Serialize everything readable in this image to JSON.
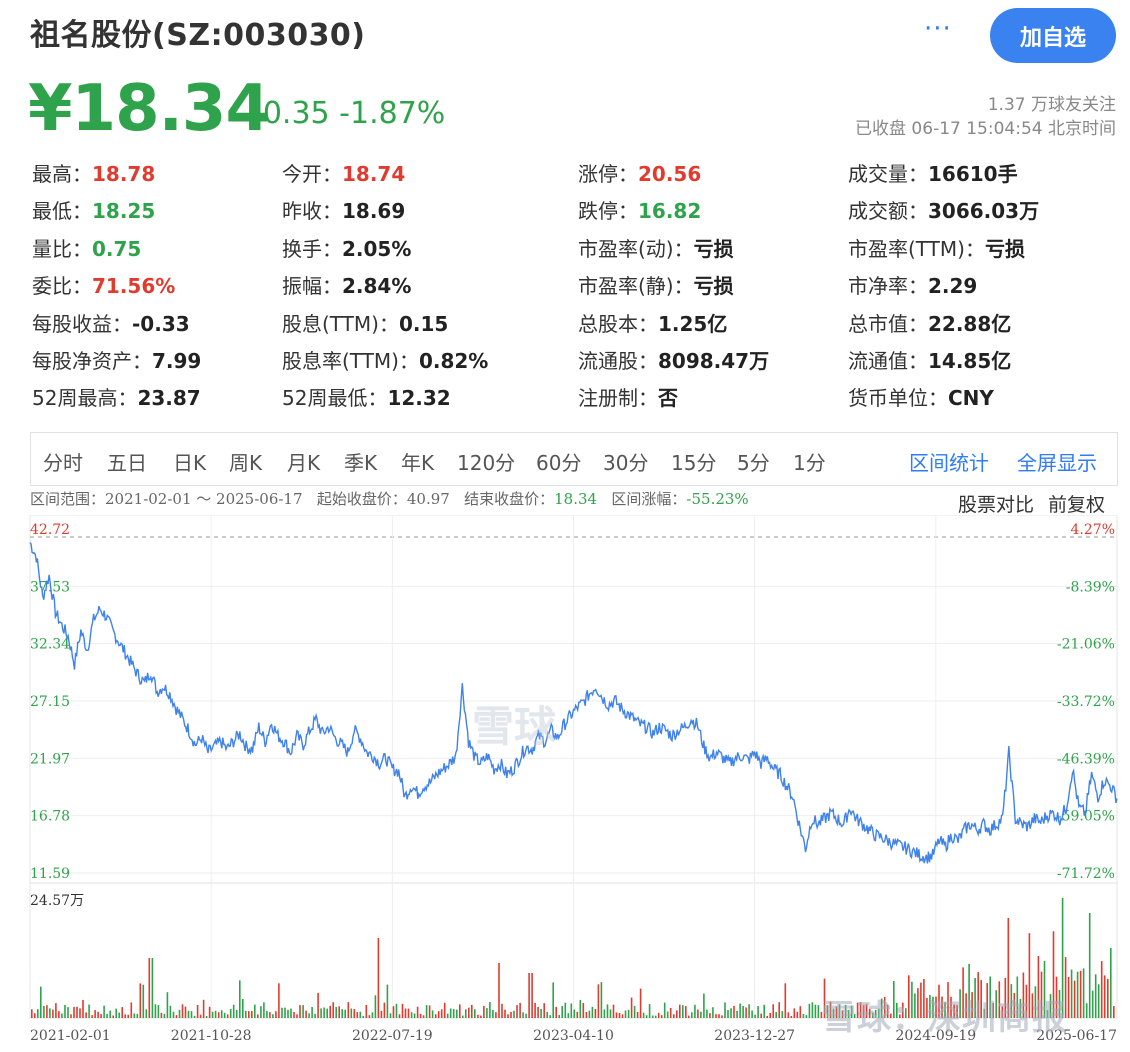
{
  "header": {
    "title": "祖名股份(SZ:003030)",
    "add_label": "加自选",
    "more_label": "···"
  },
  "quote": {
    "price": "¥18.34",
    "change": "-0.35 -1.87%",
    "followers": "1.37 万球友关注",
    "status": "已收盘 06-17 15:04:54 北京时间"
  },
  "stats": [
    {
      "label": "最高：",
      "value": "18.78",
      "color": "red"
    },
    {
      "label": "今开：",
      "value": "18.74",
      "color": "red"
    },
    {
      "label": "涨停：",
      "value": "20.56",
      "color": "red"
    },
    {
      "label": "成交量：",
      "value": "16610手",
      "color": ""
    },
    {
      "label": "最低：",
      "value": "18.25",
      "color": "green"
    },
    {
      "label": "昨收：",
      "value": "18.69",
      "color": ""
    },
    {
      "label": "跌停：",
      "value": "16.82",
      "color": "green"
    },
    {
      "label": "成交额：",
      "value": "3066.03万",
      "color": ""
    },
    {
      "label": "量比：",
      "value": "0.75",
      "color": "green"
    },
    {
      "label": "换手：",
      "value": "2.05%",
      "color": ""
    },
    {
      "label": "市盈率(动)：",
      "value": "亏损",
      "color": ""
    },
    {
      "label": "市盈率(TTM)：",
      "value": "亏损",
      "color": ""
    },
    {
      "label": "委比：",
      "value": "71.56%",
      "color": "red"
    },
    {
      "label": "振幅：",
      "value": "2.84%",
      "color": ""
    },
    {
      "label": "市盈率(静)：",
      "value": "亏损",
      "color": ""
    },
    {
      "label": "市净率：",
      "value": "2.29",
      "color": ""
    },
    {
      "label": "每股收益：",
      "value": "-0.33",
      "color": ""
    },
    {
      "label": "股息(TTM)：",
      "value": "0.15",
      "color": ""
    },
    {
      "label": "总股本：",
      "value": "1.25亿",
      "color": ""
    },
    {
      "label": "总市值：",
      "value": "22.88亿",
      "color": ""
    },
    {
      "label": "每股净资产：",
      "value": "7.99",
      "color": ""
    },
    {
      "label": "股息率(TTM)：",
      "value": "0.82%",
      "color": ""
    },
    {
      "label": "流通股：",
      "value": "8098.47万",
      "color": ""
    },
    {
      "label": "流通值：",
      "value": "14.85亿",
      "color": ""
    },
    {
      "label": "52周最高：",
      "value": "23.87",
      "color": ""
    },
    {
      "label": "52周最低：",
      "value": "12.32",
      "color": ""
    },
    {
      "label": "注册制：",
      "value": "否",
      "color": ""
    },
    {
      "label": "货币单位：",
      "value": "CNY",
      "color": ""
    }
  ],
  "tabs": [
    "分时",
    "五日",
    "日K",
    "周K",
    "月K",
    "季K",
    "年K",
    "120分",
    "60分",
    "30分",
    "15分",
    "5分",
    "1分"
  ],
  "tab_actions": [
    "区间统计",
    "全屏显示"
  ],
  "range": {
    "range_label": "区间范围：",
    "range_value": "2021-02-01 ～ 2025-06-17",
    "start_label": "起始收盘价：",
    "start_value": "40.97",
    "end_label": "结束收盘价：",
    "end_value": "18.34",
    "pct_label": "区间涨幅：",
    "pct_value": "-55.23%",
    "compare": "股票对比",
    "adjust": "前复权"
  },
  "watermarks": {
    "center": "雪球",
    "corner": "雪球：深圳商报"
  },
  "chart_data": {
    "type": "line",
    "y_ticks": [
      "42.72",
      "37.53",
      "32.34",
      "27.15",
      "21.97",
      "16.78",
      "11.59"
    ],
    "y_pct_ticks": [
      "4.27%",
      "-8.39%",
      "-21.06%",
      "-33.72%",
      "-46.39%",
      "-59.05%",
      "-71.72%"
    ],
    "ylim": [
      11.59,
      42.72
    ],
    "volume_max_label": "24.57万",
    "x_ticks": [
      "2021-02-01",
      "2021-10-28",
      "2022-07-19",
      "2023-04-10",
      "2023-12-27",
      "2024-09-19",
      "2025-06-17"
    ],
    "series": [
      {
        "values": [
          41.5,
          40.2,
          36.5,
          38.5,
          35.2,
          34.0,
          33.0,
          30.5,
          33.5,
          31.8,
          34.5,
          35.5,
          34.8,
          33.5,
          32.5,
          31.5,
          30.5,
          29.5,
          28.8,
          29.8,
          28.0,
          28.5,
          27.8,
          26.5,
          25.5,
          24.5,
          23.2,
          23.8,
          22.5,
          23.0,
          23.5,
          22.8,
          23.5,
          24.2,
          23.0,
          22.8,
          24.8,
          23.5,
          25.2,
          24.0,
          23.5,
          22.5,
          24.0,
          23.2,
          24.5,
          25.5,
          24.2,
          24.8,
          23.8,
          23.2,
          22.5,
          24.5,
          23.8,
          22.5,
          22.2,
          21.5,
          22.0,
          21.0,
          20.8,
          18.5,
          19.5,
          18.8,
          19.5,
          19.8,
          20.5,
          21.0,
          21.5,
          22.2,
          28.5,
          23.5,
          22.0,
          21.5,
          22.2,
          21.0,
          21.5,
          20.5,
          21.0,
          22.0,
          23.0,
          22.8,
          24.0,
          23.5,
          24.5,
          23.8,
          25.0,
          25.8,
          26.5,
          27.0,
          27.8,
          28.5,
          27.5,
          26.8,
          27.2,
          26.5,
          26.0,
          25.5,
          25.0,
          24.8,
          24.2,
          24.8,
          24.5,
          24.0,
          24.5,
          24.8,
          25.5,
          25.0,
          23.0,
          22.0,
          22.5,
          22.0,
          21.5,
          22.0,
          22.2,
          21.8,
          22.5,
          21.5,
          22.0,
          21.0,
          20.5,
          19.5,
          18.5,
          16.0,
          13.8,
          16.5,
          16.0,
          16.5,
          17.0,
          16.5,
          16.0,
          17.5,
          16.5,
          16.0,
          15.5,
          15.0,
          14.8,
          14.5,
          14.2,
          14.0,
          13.8,
          13.5,
          13.2,
          13.0,
          13.2,
          14.5,
          14.0,
          15.0,
          14.5,
          15.5,
          16.0,
          15.5,
          16.0,
          15.5,
          16.0,
          16.5,
          22.5,
          16.5,
          16.0,
          15.8,
          16.5,
          16.2,
          16.8,
          17.0,
          16.5,
          17.5,
          21.0,
          17.5,
          17.0,
          20.5,
          18.5,
          20.0,
          19.5,
          18.34
        ]
      }
    ]
  }
}
